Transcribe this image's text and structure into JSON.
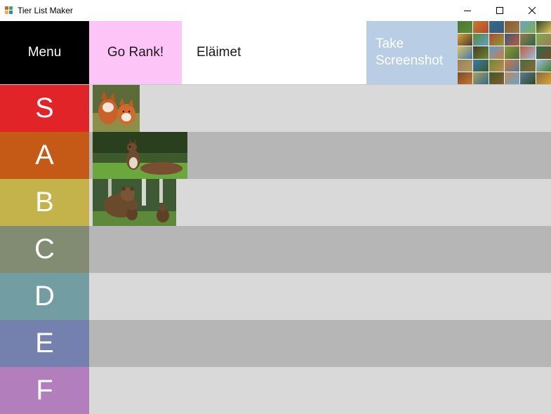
{
  "window": {
    "title": "Tier List Maker",
    "icon": "app-grid-icon",
    "controls": [
      "minimize-icon",
      "maximize-icon",
      "close-icon"
    ]
  },
  "toolbar": {
    "menu_label": "Menu",
    "rank_label": "Go Rank!",
    "list_name": "Eläimet",
    "screenshot_label_line1": "Take",
    "screenshot_label_line2": "Screenshot",
    "colors": {
      "menu": "#000000",
      "rank": "#fdc4f8",
      "screenshot": "#b9cee4"
    }
  },
  "tiers": [
    {
      "label": "S",
      "color": "#e02427",
      "items": [
        {
          "name": "fox-pair-image"
        }
      ]
    },
    {
      "label": "A",
      "color": "#c55a17",
      "items": [
        {
          "name": "squirrel-image"
        }
      ]
    },
    {
      "label": "B",
      "color": "#c4b34b",
      "items": [
        {
          "name": "bear-family-image"
        }
      ]
    },
    {
      "label": "C",
      "color": "#818c72",
      "items": []
    },
    {
      "label": "D",
      "color": "#729da2",
      "items": []
    },
    {
      "label": "E",
      "color": "#7480ae",
      "items": []
    },
    {
      "label": "F",
      "color": "#b27ebc",
      "items": []
    }
  ]
}
